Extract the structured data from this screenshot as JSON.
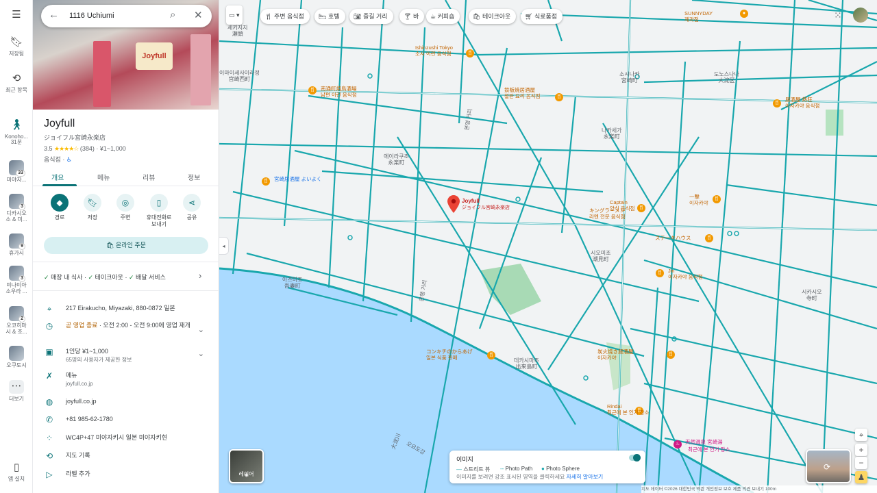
{
  "colors": {
    "accent": "#0b7377",
    "road": "#19a7ad",
    "water": "#aadaff",
    "pin": "#ea4335"
  },
  "rail": {
    "items": [
      {
        "label": "저장됨",
        "icon": "bookmark-icon"
      },
      {
        "label": "최근 항목",
        "icon": "history-icon"
      },
      {
        "label": "Konoho...\n31분",
        "icon": "walk-icon"
      },
      {
        "label": "미야자...",
        "badge": "33"
      },
      {
        "label": "디카시오\n소 & 미...",
        "badge": "3"
      },
      {
        "label": "휴가시",
        "badge": "9"
      },
      {
        "label": "미나미아\n소우라 ...",
        "badge": "3"
      },
      {
        "label": "오코히마\n시 & 조...",
        "badge": "2"
      },
      {
        "label": "오쿠토시",
        "badge": ""
      },
      {
        "label": "더보기",
        "icon": "more-icon"
      },
      {
        "label": "앱 설치",
        "icon": "phone-icon"
      }
    ]
  },
  "search": {
    "value": "1116 Uchiumi"
  },
  "place": {
    "name": "Joyfull",
    "subname": "ジョイフル宮崎永楽店",
    "rating": "3.5",
    "stars": "★★★★☆",
    "reviews": "(384)",
    "price": "· ¥1~1,000",
    "category": "음식점 · ",
    "photo_sign": "Joyfull"
  },
  "tabs": [
    "개요",
    "메뉴",
    "리뷰",
    "정보"
  ],
  "actions": [
    {
      "label": "경로",
      "icon": "directions-icon"
    },
    {
      "label": "저장",
      "icon": "bookmark-icon"
    },
    {
      "label": "주변",
      "icon": "nearby-icon"
    },
    {
      "label": "휴대전화로\n보내기",
      "icon": "phone-send-icon"
    },
    {
      "label": "공유",
      "icon": "share-icon"
    }
  ],
  "order_button": "온라인 주문",
  "services": {
    "items": [
      "매장 내 식사",
      "테이크아웃",
      "배달 서비스"
    ]
  },
  "info": {
    "address": "217 Eirakucho, Miyazaki, 880-0872 일본",
    "hours_status": "곧 영업 종료",
    "hours_detail": " · 오전 2:00 - 오전 9:00에 영업 재개",
    "price_main": "1인당 ¥1~1,000",
    "price_sub": "65명의 사용자가 제공한 정보",
    "menu_label": "메뉴",
    "menu_url": "joyfull.co.jp",
    "website": "joyfull.co.jp",
    "phone": "+81 985-62-1780",
    "pluscode": "WC4P+47 미야자키시 일본 미야자키현",
    "history": "지도 기록",
    "add_label": "라벨 추가"
  },
  "map": {
    "chips": [
      "주변 음식점",
      "호텔",
      "즐길 거리",
      "바",
      "커피숍",
      "테이크아웃",
      "식료품점"
    ],
    "place_labels": [
      {
        "text": "세키지지\n瀬頭"
      },
      {
        "text": "이마이세사이라정\n宮崎西町"
      },
      {
        "text": "소시나카\n宮崎町"
      },
      {
        "text": "나카세가\n永楽町"
      },
      {
        "text": "도노스나나\n大淀区"
      },
      {
        "text": "에이라쿠조\n永楽町"
      },
      {
        "text": "미야고쿠\n高楠町"
      },
      {
        "text": "시오미조\n潮見町"
      },
      {
        "text": "아즈미조\n吾妻町"
      },
      {
        "text": "시카시오\n寺町"
      },
      {
        "text": "데카시마조\n出来島町"
      },
      {
        "text": "오요도강"
      },
      {
        "text": "大淀川"
      },
      {
        "text": "본영 거리"
      },
      {
        "text": "은행 거리"
      }
    ],
    "pois": [
      {
        "text": "Ishinzushi Tokyo\n소시 이런 음식점"
      },
      {
        "text": "SUNNYDAY\n제과점"
      },
      {
        "text": "南通町焼鳥酒場\n남편 이런 음식점"
      },
      {
        "text": "鉄板焼居酒屋\n철판 요리 음식점"
      },
      {
        "text": "居酒屋 熱狂\n이자카야 음식점"
      },
      {
        "text": "宮崎居酒屋 よいよく"
      },
      {
        "text": "Captain\n양식 음식점"
      },
      {
        "text": "一撃\n이자카야"
      },
      {
        "text": "キングラーメン\n라멘 전문 음식점"
      },
      {
        "text": "ステーキハウス"
      },
      {
        "text": "Jin\n이자카야 음식점"
      },
      {
        "text": "コンキチのからあげ\n일본 식품 판매"
      },
      {
        "text": "炭火焼き居酒屋\n이자카야"
      },
      {
        "text": "Rindai\n최근에 본 인기 장소"
      },
      {
        "text": "天然温泉 宮崎湯"
      },
      {
        "text": "최근에 본 인기 장소"
      }
    ],
    "selected_pin": {
      "name": "Joyfull",
      "sub": "ジョイフル宮崎永楽店"
    },
    "layers_label": "레이어",
    "legend": {
      "title": "이미지",
      "items": [
        "스트리트 뷰",
        "Photo Path",
        "Photo Sphere"
      ],
      "note": "이미지를 보려면 강조 표시된 영역을 클릭하세요",
      "link": "자세히 알아보기"
    },
    "footer": "지도 데이터 ©2026   대한민국   약관   개인정보 보호   제품 의견 보내기   100m"
  }
}
